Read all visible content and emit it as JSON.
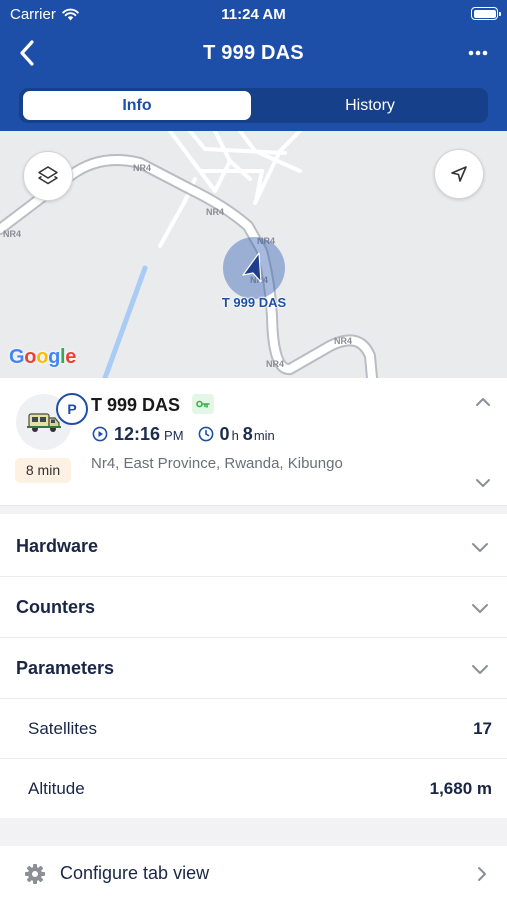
{
  "status_bar": {
    "carrier": "Carrier",
    "time": "11:24 AM",
    "battery_level": 1.0
  },
  "nav": {
    "title": "T 999 DAS",
    "back_icon": "chevron-left-icon",
    "more_icon": "more-horizontal-icon"
  },
  "tabs": [
    {
      "label": "Info",
      "active": true
    },
    {
      "label": "History",
      "active": false
    }
  ],
  "map": {
    "road_labels": [
      "NR4",
      "NR4",
      "NR4",
      "NR4",
      "NR4",
      "NR4",
      "NR4"
    ],
    "marker_label": "T 999 DAS",
    "attribution": [
      "G",
      "o",
      "o",
      "g",
      "l",
      "e"
    ]
  },
  "unit": {
    "name": "T 999 DAS",
    "parking_badge": "P",
    "parked_duration": "8 min",
    "time": "12:16",
    "time_period": "PM",
    "duration_hours": "0",
    "duration_hours_unit": "h",
    "duration_minutes": "8",
    "duration_minutes_unit": "min",
    "address": "Nr4, East Province, Rwanda, Kibungo"
  },
  "sections": [
    {
      "label": "Hardware"
    },
    {
      "label": "Counters"
    },
    {
      "label": "Parameters"
    }
  ],
  "parameters": [
    {
      "label": "Satellites",
      "value": "17"
    },
    {
      "label": "Altitude",
      "value": "1,680 m"
    }
  ],
  "configure": {
    "label": "Configure tab view"
  },
  "colors": {
    "brand": "#1e4fa8",
    "ignition_green": "#3bb34a",
    "chip_bg": "#fdf1e4"
  }
}
